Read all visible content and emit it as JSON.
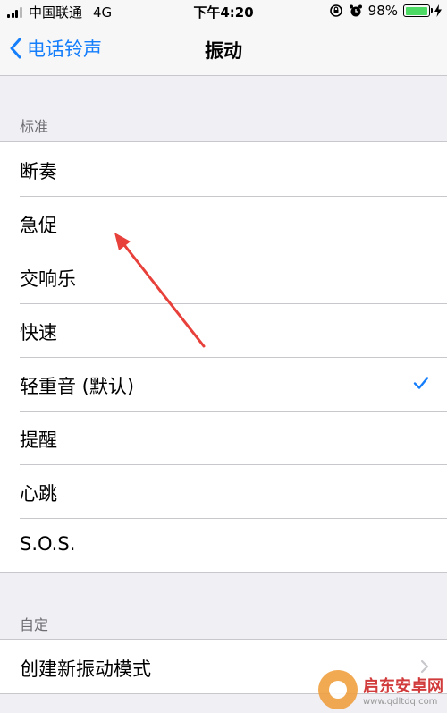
{
  "status_bar": {
    "carrier": "中国联通",
    "network": "4G",
    "time": "下午4:20",
    "battery": "98%",
    "battery_level": 0.98,
    "icons": [
      "signal-icon",
      "lock-rotation-icon",
      "alarm-icon",
      "battery-icon",
      "charging-icon"
    ]
  },
  "nav": {
    "back_label": "电话铃声",
    "title": "振动"
  },
  "standard": {
    "header": "标准",
    "items": [
      {
        "label": "断奏",
        "selected": false
      },
      {
        "label": "急促",
        "selected": false
      },
      {
        "label": "交响乐",
        "selected": false
      },
      {
        "label": "快速",
        "selected": false
      },
      {
        "label": "轻重音 (默认)",
        "selected": true
      },
      {
        "label": "提醒",
        "selected": false
      },
      {
        "label": "心跳",
        "selected": false
      },
      {
        "label": "S.O.S.",
        "selected": false
      }
    ]
  },
  "custom": {
    "header": "自定",
    "create_label": "创建新振动模式"
  },
  "watermark": {
    "title": "启东安卓网",
    "url": "www.qdltdq.com"
  },
  "colors": {
    "accent": "#157efb",
    "background": "#efeff4",
    "annotation_arrow": "#e8403a"
  }
}
